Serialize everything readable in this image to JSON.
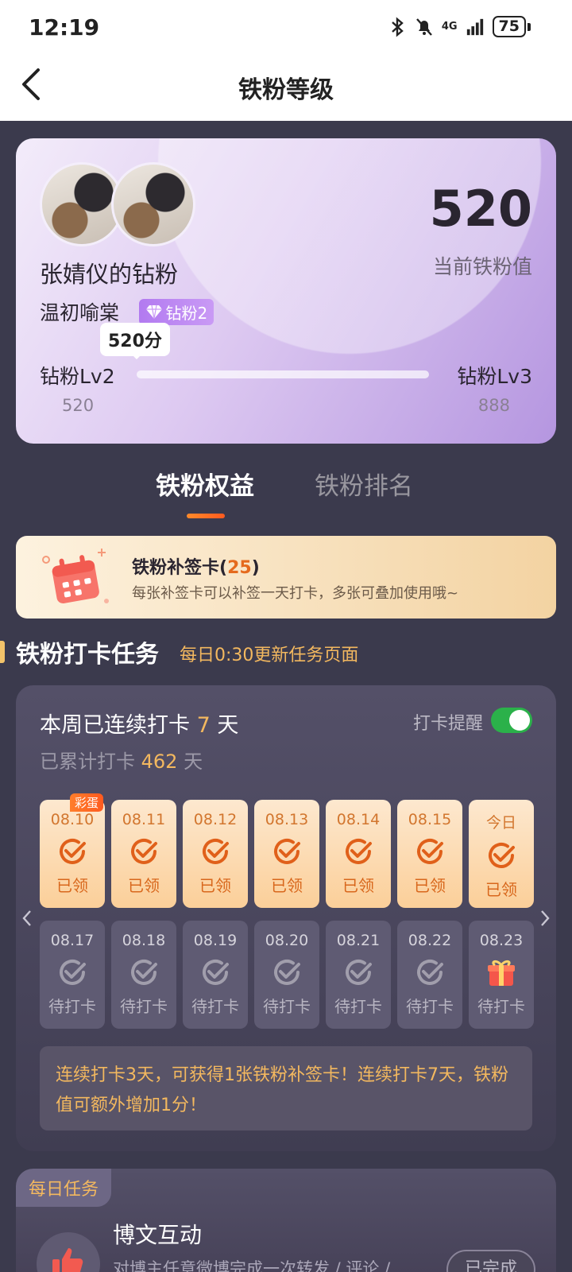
{
  "status_bar": {
    "time": "12:19",
    "network": "4G",
    "battery": "75"
  },
  "header": {
    "title": "铁粉等级"
  },
  "level_card": {
    "group_title": "张婧仪的钻粉",
    "username": "温初喻棠_",
    "badge": "钻粉2",
    "score": "520",
    "score_label": "当前铁粉值",
    "tooltip": "520分",
    "current_level": "钻粉Lv2",
    "next_level": "钻粉Lv3",
    "current_min": "520",
    "next_min": "888",
    "progress_fraction": 0
  },
  "tabs": [
    {
      "label": "铁粉权益",
      "active": true
    },
    {
      "label": "铁粉排名",
      "active": false
    }
  ],
  "resign_card": {
    "title": "铁粉补签卡",
    "count": "25",
    "description": "每张补签卡可以补签一天打卡，多张可叠加使用哦~"
  },
  "checkin_section": {
    "title": "铁粉打卡任务",
    "subtitle": "每日0:30更新任务页面"
  },
  "checkin": {
    "streak_prefix": "本周已连续打卡",
    "streak_days": "7",
    "streak_suffix": "天",
    "total_prefix": "已累计打卡",
    "total_days": "462",
    "total_suffix": "天",
    "reminder_label": "打卡提醒",
    "reminder_on": true,
    "egg_label": "彩蛋",
    "days": [
      {
        "date": "08.10",
        "status": "已领",
        "state": "done"
      },
      {
        "date": "08.11",
        "status": "已领",
        "state": "done"
      },
      {
        "date": "08.12",
        "status": "已领",
        "state": "done"
      },
      {
        "date": "08.13",
        "status": "已领",
        "state": "done"
      },
      {
        "date": "08.14",
        "status": "已领",
        "state": "done"
      },
      {
        "date": "08.15",
        "status": "已领",
        "state": "done"
      },
      {
        "date": "今日",
        "status": "已领",
        "state": "done"
      },
      {
        "date": "08.17",
        "status": "待打卡",
        "state": "todo"
      },
      {
        "date": "08.18",
        "status": "待打卡",
        "state": "todo"
      },
      {
        "date": "08.19",
        "status": "待打卡",
        "state": "todo"
      },
      {
        "date": "08.20",
        "status": "待打卡",
        "state": "todo"
      },
      {
        "date": "08.21",
        "status": "待打卡",
        "state": "todo"
      },
      {
        "date": "08.22",
        "status": "待打卡",
        "state": "todo"
      },
      {
        "date": "08.23",
        "status": "待打卡",
        "state": "gift"
      }
    ],
    "tip": "连续打卡3天，可获得1张铁粉补签卡！连续打卡7天，铁粉值可额外增加1分！"
  },
  "daily_tasks": {
    "tag": "每日任务",
    "task_title": "博文互动",
    "task_desc": "对博主任意微博完成一次转发 / 评论 /",
    "task_button": "已完成"
  },
  "colors": {
    "accent": "#f3b85f",
    "orange": "#ff5a1f",
    "toggle_on": "#2bb14a",
    "bg": "#3b3a4d"
  }
}
